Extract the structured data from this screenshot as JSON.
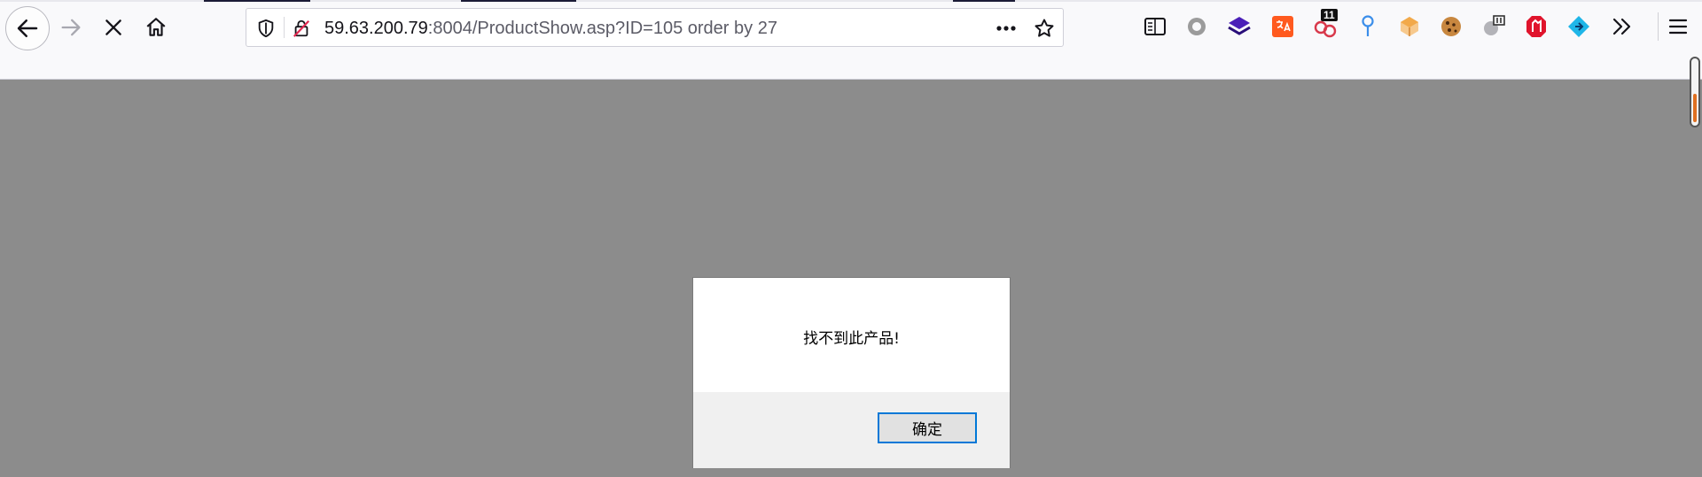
{
  "browser": {
    "url_host": "59.63.200.79",
    "url_rest": ":8004/ProductShow.asp?ID=105 order by 27",
    "nav": {
      "back": "back-arrow-icon",
      "forward": "forward-arrow-icon",
      "stop": "stop-loading-icon",
      "home": "home-icon"
    },
    "extensions": [
      {
        "name": "reader-view-icon"
      },
      {
        "name": "circle-extension-icon"
      },
      {
        "name": "layers-extension-icon",
        "color": "#4a1fb8"
      },
      {
        "name": "translate-extension-icon",
        "color": "#ff5a1f"
      },
      {
        "name": "hackbar-extension-icon",
        "badge": "11"
      },
      {
        "name": "pin-extension-icon",
        "color": "#3b8eea"
      },
      {
        "name": "box-extension-icon",
        "color": "#f2a94a"
      },
      {
        "name": "cookie-extension-icon",
        "color": "#a0642a"
      },
      {
        "name": "proxy-extension-icon"
      },
      {
        "name": "block-extension-icon",
        "color": "#e0142c"
      },
      {
        "name": "diamond-extension-icon",
        "color": "#1fb6e8"
      },
      {
        "name": "overflow-chevrons-icon"
      },
      {
        "name": "menu-hamburger-icon"
      }
    ]
  },
  "dialog": {
    "message": "找不到此产品!",
    "ok_label": "确定"
  }
}
